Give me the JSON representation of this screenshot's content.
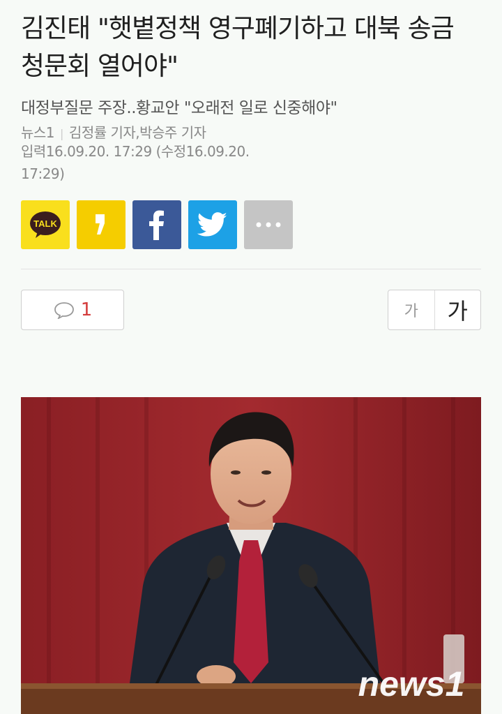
{
  "article": {
    "headline": "김진태 \"햇볕정책 영구폐기하고 대북 송금 청문회 열어야\"",
    "subtitle": "대정부질문 주장..황교안 \"오래전 일로 신중해야\"",
    "source": "뉴스1",
    "reporters": "김정률 기자,박승주 기자",
    "dates": "입력16.09.20. 17:29 (수정16.09.20. 17:29)"
  },
  "share": {
    "kakao_label": "TALK"
  },
  "toolbar": {
    "comment_count": "1",
    "font_small_label": "가",
    "font_large_label": "가"
  },
  "photo": {
    "watermark": "news1"
  },
  "colors": {
    "kakao": "#f9df1d",
    "kakaostory": "#f5cd00",
    "facebook": "#3b5998",
    "twitter": "#1da1e6",
    "more": "#c5c5c5",
    "comment_count": "#d33b3b"
  }
}
